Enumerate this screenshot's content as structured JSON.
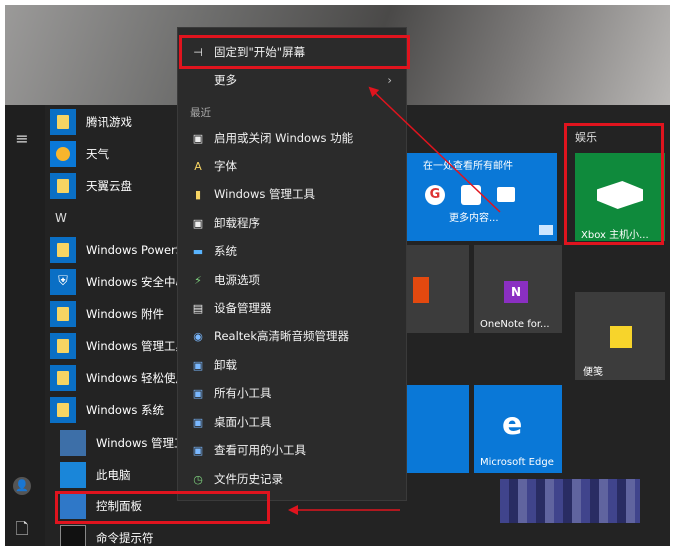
{
  "app_list": {
    "items_top": [
      {
        "label": "腾讯游戏"
      },
      {
        "label": "天气"
      },
      {
        "label": "天翼云盘"
      }
    ],
    "letter_w": "W",
    "items_w": [
      {
        "label": "Windows PowerSh"
      },
      {
        "label": "Windows 安全中心"
      },
      {
        "label": "Windows 附件"
      },
      {
        "label": "Windows 管理工具"
      },
      {
        "label": "Windows 轻松使用"
      },
      {
        "label": "Windows 系统"
      }
    ],
    "items_sub": [
      {
        "label": "Windows 管理工"
      },
      {
        "label": "此电脑"
      },
      {
        "label": "控制面板"
      },
      {
        "label": "命令提示符"
      }
    ]
  },
  "context_menu": {
    "pin_label": "固定到\"开始\"屏幕",
    "more_label": "更多",
    "recent_header": "最近",
    "recent": [
      {
        "label": "启用或关闭 Windows 功能"
      },
      {
        "label": "字体"
      },
      {
        "label": "Windows 管理工具"
      },
      {
        "label": "卸载程序"
      },
      {
        "label": "系统"
      },
      {
        "label": "电源选项"
      },
      {
        "label": "设备管理器"
      },
      {
        "label": "Realtek高清晰音频管理器"
      },
      {
        "label": "卸载"
      },
      {
        "label": "所有小工具"
      },
      {
        "label": "桌面小工具"
      },
      {
        "label": "查看可用的小工具"
      },
      {
        "label": "文件历史记录"
      }
    ]
  },
  "tiles": {
    "group_entertainment": "娱乐",
    "mail_tile_text": "在一处查看所有邮件",
    "mail_tile_more": "更多内容...",
    "xbox_label": "Xbox 主机小...",
    "onenote_label": "OneNote for...",
    "sticky_label": "便笺",
    "edge_label": "Microsoft Edge"
  },
  "colors": {
    "annotation_red": "#e0141e",
    "tile_blue": "#0a78d7"
  }
}
